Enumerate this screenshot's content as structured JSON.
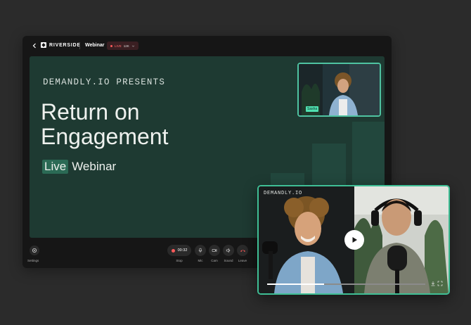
{
  "app": {
    "logo": "RIVERSIDE",
    "studio_name": "Webinar",
    "live_label": "LIVE",
    "live_count": "12K",
    "accent": "#4fc3a1"
  },
  "slide": {
    "presents": "DEMANDLY.IO PRESENTS",
    "title_line1": "Return on",
    "title_line2": "Engagement",
    "live_word": "Live",
    "subtitle": "Webinar"
  },
  "speaker": {
    "name": "Sasha"
  },
  "controls": {
    "settings": "Settings",
    "timer": "00:32",
    "stop": "Stop",
    "mic": "Mic",
    "cam": "Cam",
    "sound": "Sound",
    "leave": "Leave"
  },
  "video": {
    "brand": "DEMANDLY.IO",
    "progress_fraction": 0.36
  }
}
